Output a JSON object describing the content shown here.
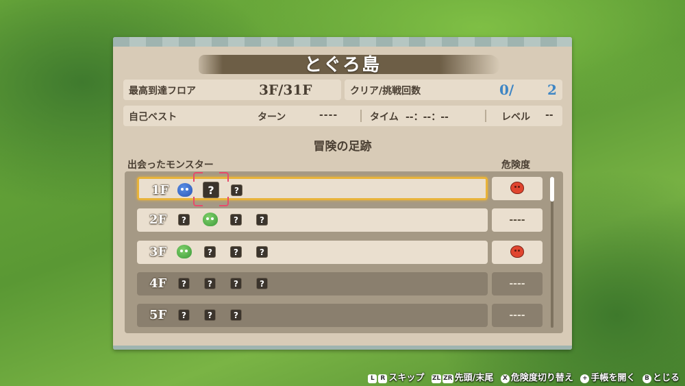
{
  "title": "とぐろ島",
  "stats": {
    "max_floor_label": "最高到達フロア",
    "max_floor_value": "3F/31F",
    "clear_label": "クリア/挑戦回数",
    "clear_count": "0/",
    "try_count": "2",
    "best_label": "自己ベスト",
    "turn_label": "ターン",
    "turn_value": "----",
    "time_label": "タイム",
    "time_value": "--：--：--",
    "level_label": "レベル",
    "level_value": "--"
  },
  "section_title": "冒険の足跡",
  "columns": {
    "monsters": "出会ったモンスター",
    "danger": "危険度"
  },
  "floors": [
    {
      "label": "1F",
      "slots": [
        "blue-monster",
        "?",
        "?"
      ],
      "danger": "",
      "danger_icon": "red-monster-icon",
      "selected": true,
      "dark": false
    },
    {
      "label": "2F",
      "slots": [
        "?",
        "green-monster",
        "?",
        "?"
      ],
      "danger": "----",
      "selected": false,
      "dark": false
    },
    {
      "label": "3F",
      "slots": [
        "green-monster",
        "?",
        "?",
        "?"
      ],
      "danger": "",
      "danger_icon": "red-monster-icon",
      "selected": false,
      "dark": false
    },
    {
      "label": "4F",
      "slots": [
        "?",
        "?",
        "?",
        "?"
      ],
      "danger": "----",
      "selected": false,
      "dark": true
    },
    {
      "label": "5F",
      "slots": [
        "?",
        "?",
        "?"
      ],
      "danger": "----",
      "selected": false,
      "dark": true
    }
  ],
  "unknown_mark": "?",
  "footer": {
    "skip_keys": [
      "L",
      "R"
    ],
    "skip_label": "スキップ",
    "jump_keys": [
      "ZL",
      "ZR"
    ],
    "jump_label": "先頭/末尾",
    "danger_key": "X",
    "danger_label": "危険度切り替え",
    "open_key": "+",
    "open_label": "手帳を開く",
    "close_key": "B",
    "close_label": "とじる"
  }
}
